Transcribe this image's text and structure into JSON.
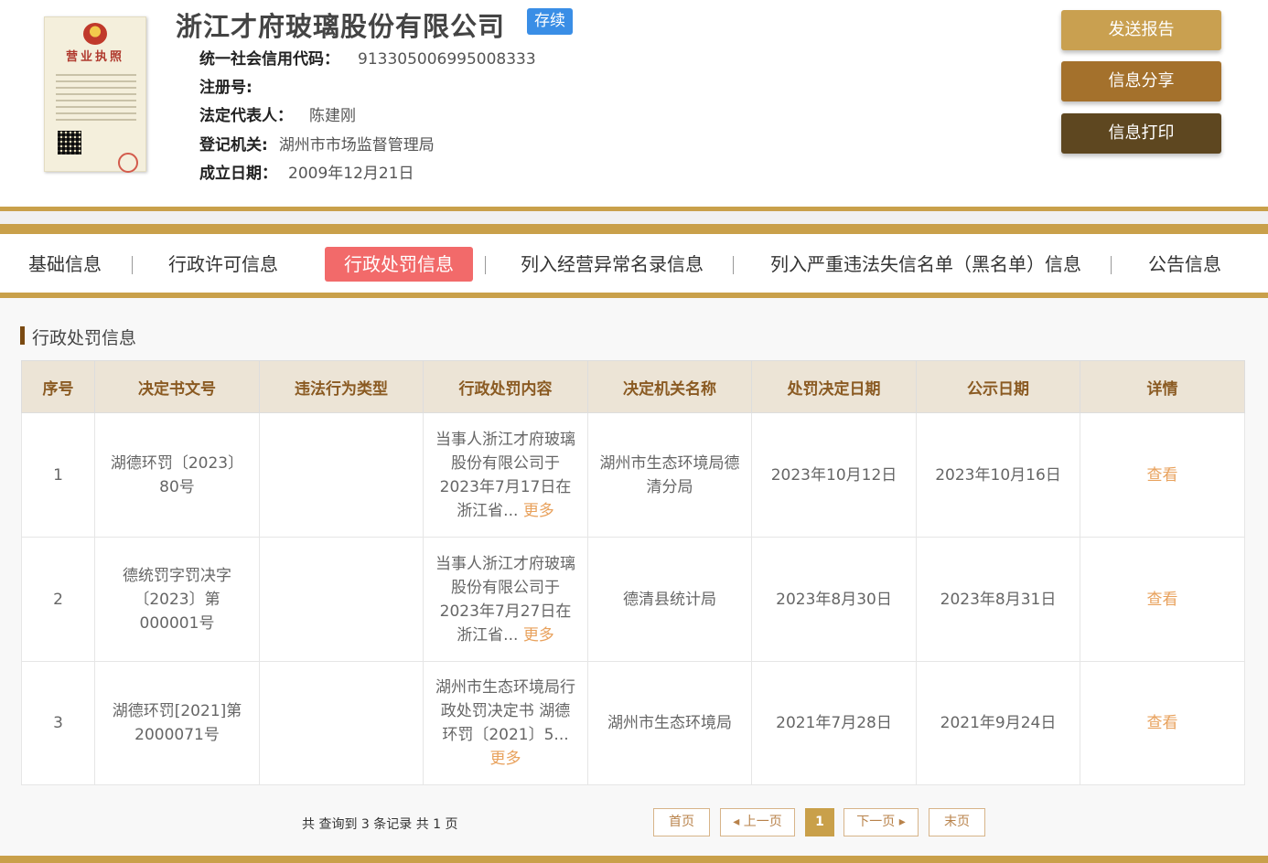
{
  "company": {
    "name": "浙江才府玻璃股份有限公司",
    "status": "存续",
    "credit_code_label": "统一社会信用代码：",
    "credit_code": "913305006995008333",
    "reg_no_label": "注册号:",
    "reg_no": "",
    "legal_rep_label": "法定代表人：",
    "legal_rep": "陈建刚",
    "reg_authority_label": "登记机关:",
    "reg_authority": "湖州市市场监督管理局",
    "founded_label": "成立日期：",
    "founded": "2009年12月21日",
    "license_title": "营业执照"
  },
  "actions": {
    "send_report": "发送报告",
    "share": "信息分享",
    "print": "信息打印"
  },
  "tabs": [
    {
      "label": "基础信息"
    },
    {
      "label": "行政许可信息"
    },
    {
      "label": "行政处罚信息",
      "active": true
    },
    {
      "label": "列入经营异常名录信息"
    },
    {
      "label": "列入严重违法失信名单（黑名单）信息"
    },
    {
      "label": "公告信息"
    }
  ],
  "section": {
    "title": "行政处罚信息"
  },
  "table": {
    "headers": [
      "序号",
      "决定书文号",
      "违法行为类型",
      "行政处罚内容",
      "决定机关名称",
      "处罚决定日期",
      "公示日期",
      "详情"
    ],
    "rows": [
      {
        "no": "1",
        "doc_no": "湖德环罚〔2023〕80号",
        "violation_type": "",
        "content": "当事人浙江才府玻璃股份有限公司于2023年7月17日在浙江省...",
        "more": "更多",
        "authority": "湖州市生态环境局德清分局",
        "decision_date": "2023年10月12日",
        "publish_date": "2023年10月16日",
        "detail": "查看"
      },
      {
        "no": "2",
        "doc_no": "德统罚字罚决字〔2023〕第000001号",
        "violation_type": "",
        "content": "当事人浙江才府玻璃股份有限公司于2023年7月27日在浙江省...",
        "more": "更多",
        "authority": "德清县统计局",
        "decision_date": "2023年8月30日",
        "publish_date": "2023年8月31日",
        "detail": "查看"
      },
      {
        "no": "3",
        "doc_no": "湖德环罚[2021]第2000071号",
        "violation_type": "",
        "content": "湖州市生态环境局行政处罚决定书 湖德环罚〔2021〕5...",
        "more": "更多",
        "authority": "湖州市生态环境局",
        "decision_date": "2021年7月28日",
        "publish_date": "2021年9月24日",
        "detail": "查看"
      }
    ]
  },
  "pagination": {
    "summary": "共 查询到 3 条记录 共 1 页",
    "first": "首页",
    "prev": "上一页",
    "current": "1",
    "next": "下一页",
    "last": "末页"
  },
  "colors": {
    "gold": "#c9a04a",
    "active_tab": "#f26a6a",
    "status_badge": "#3a8ee6",
    "link": "#e8a15c"
  }
}
